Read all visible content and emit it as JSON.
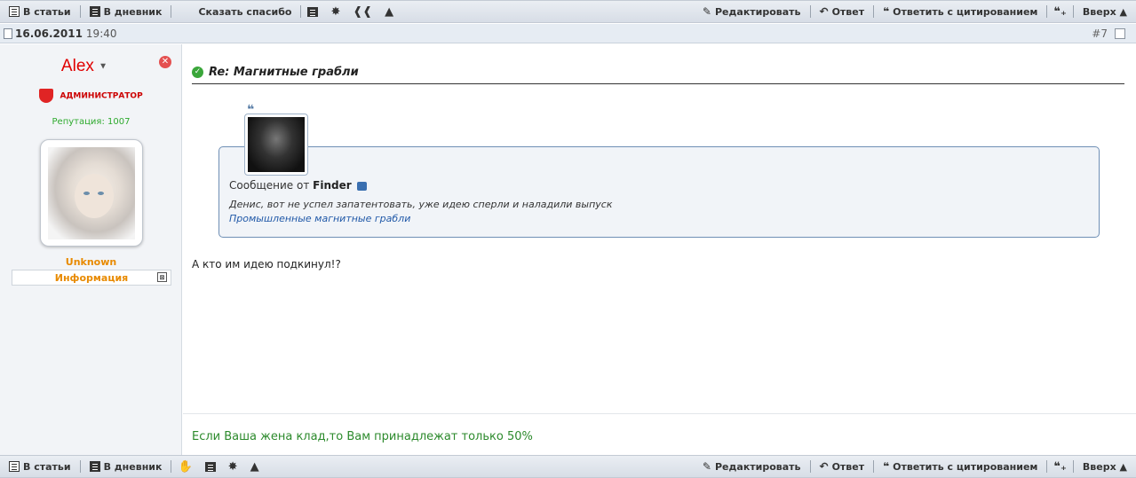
{
  "toolbar_top": {
    "to_articles": "В статьи",
    "to_diary": "В дневник",
    "thanks": "Сказать спасибо",
    "edit": "Редактировать",
    "reply": "Ответ",
    "reply_quote": "Ответить с цитированием",
    "up": "Вверх ▲"
  },
  "toolbar_bottom": {
    "to_articles": "В статьи",
    "to_diary": "В дневник",
    "edit": "Редактировать",
    "reply": "Ответ",
    "reply_quote": "Ответить с цитированием",
    "up": "Вверх ▲"
  },
  "post": {
    "date": "16.06.2011",
    "time": "19:40",
    "number": "#7",
    "title": "Re: Магнитные грабли",
    "body": "А кто им идею подкинул!?",
    "signature": "Если Ваша жена клад,то Вам принадлежат только 50%"
  },
  "author": {
    "name": "Alex",
    "role": "АДМИНИСТРАТОР",
    "reputation": "Репутация: 1007",
    "status": "Unknown",
    "info_label": "Информация"
  },
  "quote": {
    "from_label": "Сообщение от",
    "author": "Finder",
    "text": "Денис, вот не успел запатентовать, уже идею сперли и наладили выпуск",
    "link": "Промышленные магнитные грабли"
  },
  "colors": {
    "username": "#e00000",
    "reputation": "#2eaa2e",
    "status": "#e88a00",
    "signature": "#2c8a2c",
    "link": "#2159a8"
  }
}
